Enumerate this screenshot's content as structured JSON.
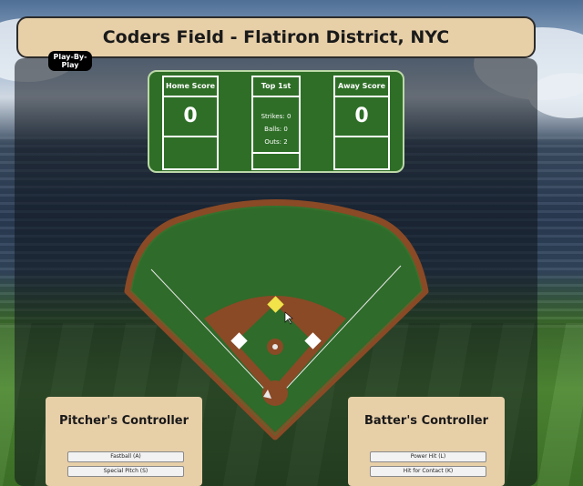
{
  "title": "Coders Field - Flatiron District, NYC",
  "play_by_play_button": "Play-By-Play",
  "scoreboard": {
    "home_label": "Home Score",
    "home_score": "0",
    "inning": "Top 1st",
    "strikes": "Strikes: 0",
    "balls": "Balls: 0",
    "outs": "Outs: 2",
    "away_label": "Away Score",
    "away_score": "0"
  },
  "pitcher_controller": {
    "title": "Pitcher's Controller",
    "buttons": [
      "Fastball (A)",
      "Special Pitch (S)"
    ]
  },
  "batter_controller": {
    "title": "Batter's Controller",
    "buttons": [
      "Power Hit (L)",
      "Hit for Contact (K)"
    ]
  },
  "colors": {
    "title_bg": "#e7cfa8",
    "scoreboard_bg": "#2e6e27",
    "field_green": "#2f6b2a",
    "dirt": "#8a4a26",
    "runner_base": "#f2e34a"
  },
  "runners": {
    "first": false,
    "second": true,
    "third": false
  }
}
